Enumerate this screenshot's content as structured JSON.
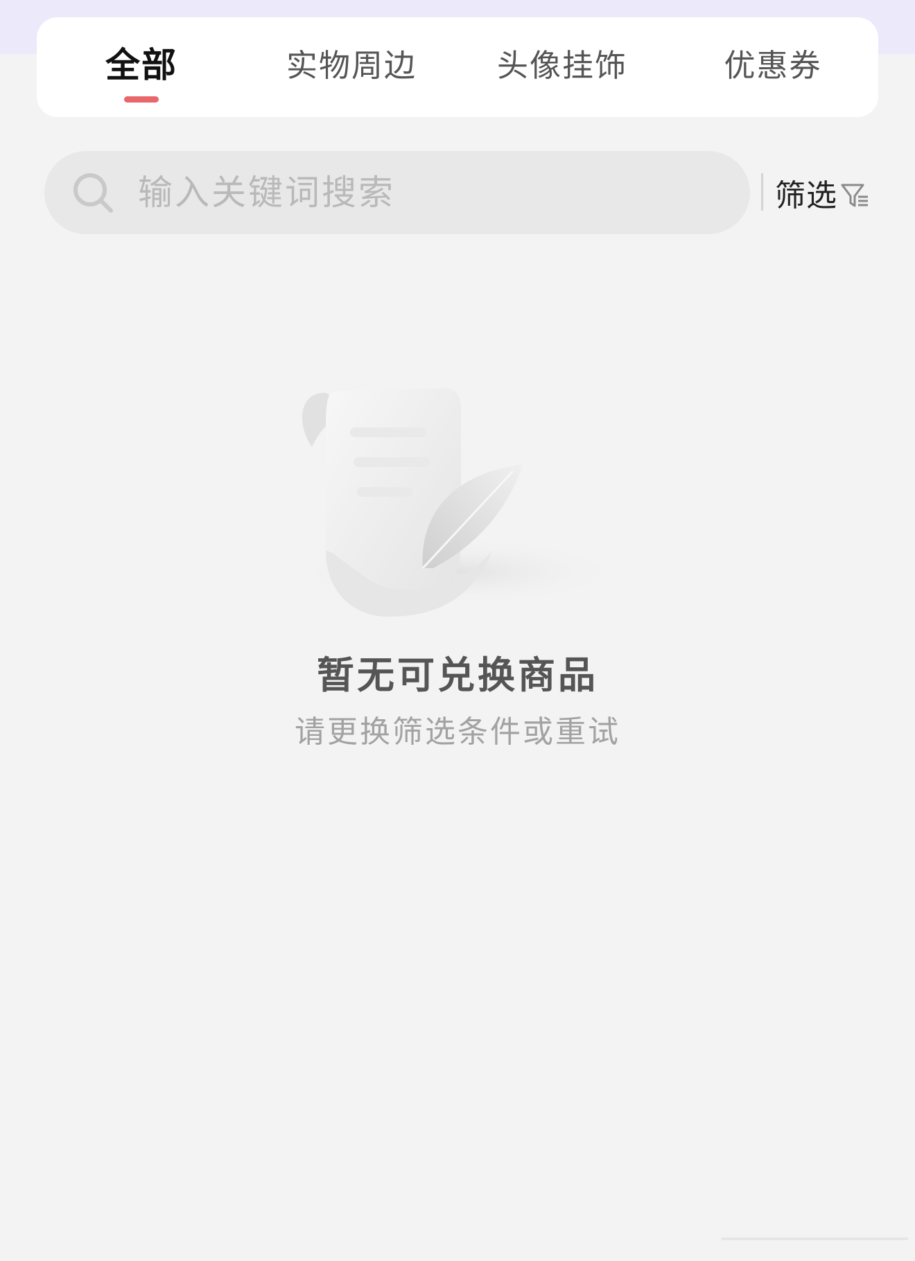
{
  "tabs": [
    {
      "label": "全部",
      "active": true
    },
    {
      "label": "实物周边",
      "active": false
    },
    {
      "label": "头像挂饰",
      "active": false
    },
    {
      "label": "优惠券",
      "active": false
    }
  ],
  "search": {
    "placeholder": "输入关键词搜索",
    "value": "",
    "icon": "search-icon"
  },
  "filter": {
    "label": "筛选",
    "icon": "filter-icon"
  },
  "empty_state": {
    "title": "暂无可兑换商品",
    "subtitle": "请更换筛选条件或重试",
    "illustration": "scroll-with-feather-illustration"
  },
  "colors": {
    "accent": "#e8676b",
    "top_band": "#ece9fb",
    "background": "#f3f3f3"
  }
}
